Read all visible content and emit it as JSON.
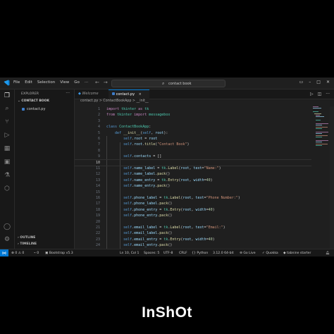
{
  "titlebar": {
    "menu": [
      "File",
      "Edit",
      "Selection",
      "View",
      "Go",
      "···"
    ],
    "search_text": "contact book"
  },
  "sidebar": {
    "title": "EXPLORER",
    "more": "···",
    "folder": "CONTACT BOOK",
    "file": "contact.py",
    "outline": "OUTLINE",
    "timeline": "TIMELINE"
  },
  "tabs": [
    {
      "label": "Welcome"
    },
    {
      "label": "contact.py",
      "close": "×"
    }
  ],
  "breadcrumb": "contact.py > ContactBookApp > __init__",
  "code_lines": [
    {
      "n": "1",
      "t": "import tkinter as tk"
    },
    {
      "n": "2",
      "t": "from tkinter import messagebox"
    },
    {
      "n": "3",
      "t": ""
    },
    {
      "n": "4",
      "t": "class ContactBookApp:"
    },
    {
      "n": "5",
      "t": "    def __init__(self, root):"
    },
    {
      "n": "6",
      "t": "        self.root = root"
    },
    {
      "n": "7",
      "t": "        self.root.title(\"Contact Book\")"
    },
    {
      "n": "8",
      "t": ""
    },
    {
      "n": "9",
      "t": "        self.contacts = []"
    },
    {
      "n": "10",
      "t": ""
    },
    {
      "n": "11",
      "t": "        self.name_label = tk.Label(root, text=\"Name:\")"
    },
    {
      "n": "12",
      "t": "        self.name_label.pack()"
    },
    {
      "n": "13",
      "t": "        self.name_entry = tk.Entry(root, width=40)"
    },
    {
      "n": "14",
      "t": "        self.name_entry.pack()"
    },
    {
      "n": "15",
      "t": ""
    },
    {
      "n": "16",
      "t": "        self.phone_label = tk.Label(root, text=\"Phone Number:\")"
    },
    {
      "n": "17",
      "t": "        self.phone_label.pack()"
    },
    {
      "n": "18",
      "t": "        self.phone_entry = tk.Entry(root, width=40)"
    },
    {
      "n": "19",
      "t": "        self.phone_entry.pack()"
    },
    {
      "n": "20",
      "t": ""
    },
    {
      "n": "21",
      "t": "        self.email_label = tk.Label(root, text=\"Email:\")"
    },
    {
      "n": "22",
      "t": "        self.email_label.pack()"
    },
    {
      "n": "23",
      "t": "        self.email_entry = tk.Entry(root, width=40)"
    },
    {
      "n": "24",
      "t": "        self.email_entry.pack()"
    }
  ],
  "current_line": "10",
  "status": {
    "errors": "0",
    "warnings": "0",
    "ports": "0",
    "bootstrap": "Bootstrap v5.3",
    "position": "Ln 10, Col 1",
    "spaces": "Spaces: 5",
    "encoding": "UTF-8",
    "eol": "CRLF",
    "language": "Python",
    "interpreter": "3.12.0 64-bit",
    "golive": "Go Live",
    "quokka": "Quokka",
    "tabnine": "tabnine starter"
  },
  "watermark": "InShOt",
  "colors": {
    "accent": "#0078d4",
    "editor_bg": "#1f1f1f",
    "sidebar_bg": "#181818"
  }
}
